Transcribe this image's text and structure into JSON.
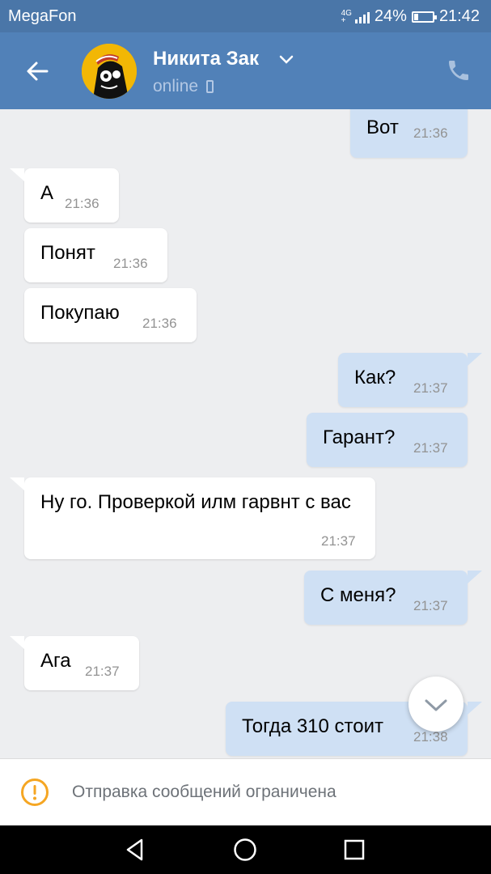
{
  "status_bar": {
    "carrier": "MegaFon",
    "network_top": "4G",
    "network_bottom": "+",
    "battery": "24%",
    "battery_level": 0.24,
    "time": "21:42"
  },
  "header": {
    "contact_name": "Никита Зак",
    "status": "online"
  },
  "messages": [
    {
      "direction": "out",
      "text": "Вот",
      "time": "21:36"
    },
    {
      "direction": "in",
      "text": "А",
      "time": "21:36"
    },
    {
      "direction": "in",
      "text": "Понят",
      "time": "21:36"
    },
    {
      "direction": "in",
      "text": "Покупаю",
      "time": "21:36"
    },
    {
      "direction": "out",
      "text": "Как?",
      "time": "21:37"
    },
    {
      "direction": "out",
      "text": "Гарант?",
      "time": "21:37"
    },
    {
      "direction": "in",
      "text": "Ну го.  Проверкой илм гарвнт с вас",
      "time": "21:37"
    },
    {
      "direction": "out",
      "text": "С меня?",
      "time": "21:37"
    },
    {
      "direction": "in",
      "text": "Ага",
      "time": "21:37"
    },
    {
      "direction": "out",
      "text": "Тогда 310 стоит",
      "time": "21:38"
    }
  ],
  "restriction_notice": {
    "text": "Отправка сообщений ограничена"
  },
  "icons": {
    "back": "arrow-left-icon",
    "dropdown": "chevron-down-icon",
    "call": "phone-icon",
    "scroll": "chevron-down-icon",
    "warning": "warning-icon",
    "nav_back": "triangle-back-icon",
    "nav_home": "circle-home-icon",
    "nav_recent": "square-recent-icon"
  },
  "colors": {
    "header": "#5181b8",
    "status_bar": "#4a76a8",
    "incoming_bubble": "#ffffff",
    "outgoing_bubble": "#cfe0f4",
    "warning": "#f5a623"
  }
}
